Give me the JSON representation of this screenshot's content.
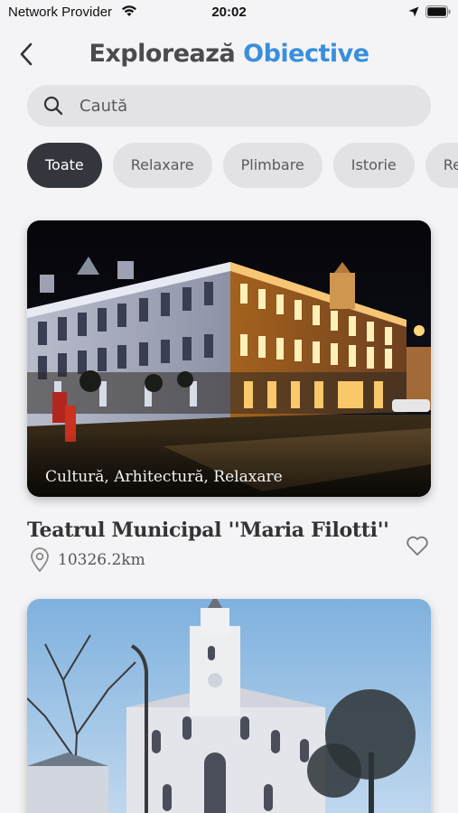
{
  "status": {
    "carrier": "Network Provider",
    "time": "20:02"
  },
  "header": {
    "title_plain": "Explorează",
    "title_accent": "Obiective"
  },
  "search": {
    "placeholder": "Caută"
  },
  "filters": [
    "Toate",
    "Relaxare",
    "Plimbare",
    "Istorie",
    "Re"
  ],
  "cards": [
    {
      "tags": "Cultură, Arhitectură, Relaxare",
      "name": "Teatrul Municipal ''Maria Filotti''",
      "distance": "10326.2km"
    }
  ],
  "colors": {
    "accent": "#3a8fdc",
    "active_chip": "#33373d"
  }
}
